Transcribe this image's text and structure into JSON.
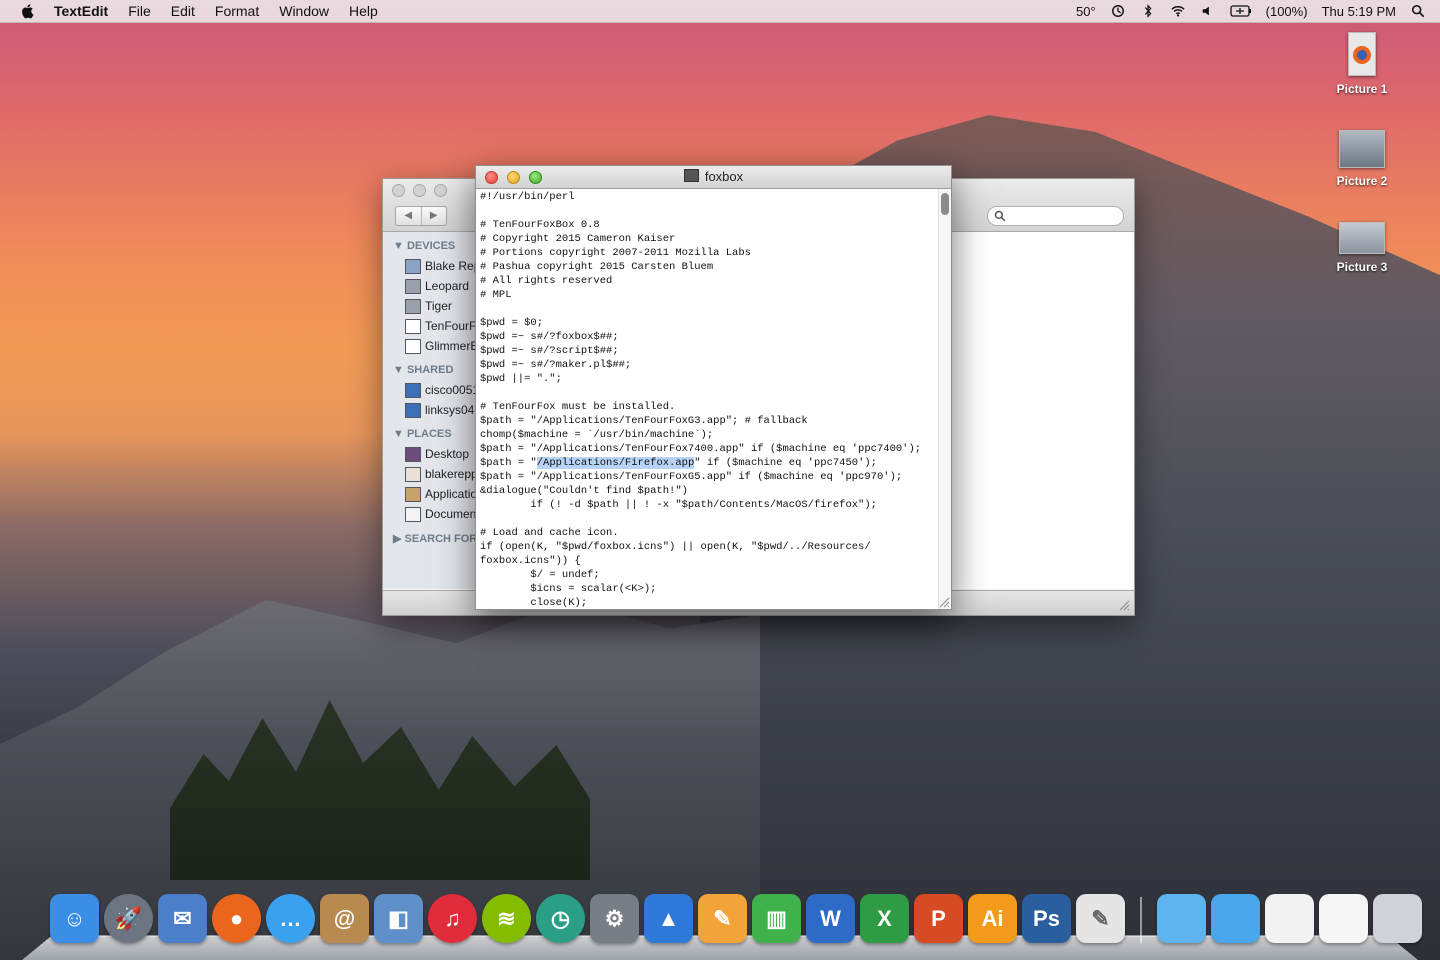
{
  "menubar": {
    "app_name": "TextEdit",
    "menus": [
      "File",
      "Edit",
      "Format",
      "Window",
      "Help"
    ],
    "status": {
      "temperature": "50°",
      "battery": "(100%)",
      "clock": "Thu 5:19 PM"
    }
  },
  "desktop_icons": [
    {
      "label": "Picture 1"
    },
    {
      "label": "Picture 2"
    },
    {
      "label": "Picture 3"
    }
  ],
  "finder": {
    "sidebar": {
      "devices_header": "DEVICES",
      "devices": [
        "Blake Rep",
        "Leopard",
        "Tiger",
        "TenFourF",
        "GlimmerB"
      ],
      "shared_header": "SHARED",
      "shared": [
        "cisco0051",
        "linksys04"
      ],
      "places_header": "PLACES",
      "places": [
        "Desktop",
        "blakerepp",
        "Applicatio",
        "Documen"
      ],
      "search_header": "SEARCH FOR"
    }
  },
  "textedit": {
    "title": "foxbox",
    "code": {
      "before": "#!/usr/bin/perl\n\n# TenFourFoxBox 0.8\n# Copyright 2015 Cameron Kaiser\n# Portions copyright 2007-2011 Mozilla Labs\n# Pashua copyright 2015 Carsten Bluem\n# All rights reserved\n# MPL\n\n$pwd = $0;\n$pwd =~ s#/?foxbox$##;\n$pwd =~ s#/?script$##;\n$pwd =~ s#/?maker.pl$##;\n$pwd ||= \".\";\n\n# TenFourFox must be installed.\n$path = \"/Applications/TenFourFoxG3.app\"; # fallback\nchomp($machine = `/usr/bin/machine`);\n$path = \"/Applications/TenFourFox7400.app\" if ($machine eq 'ppc7400');\n$path = \"",
      "selected": "/Applications/Firefox.app",
      "after": "\" if ($machine eq 'ppc7450');\n$path = \"/Applications/TenFourFoxG5.app\" if ($machine eq 'ppc970');\n&dialogue(\"Couldn't find $path!\")\n        if (! -d $path || ! -x \"$path/Contents/MacOS/firefox\");\n\n# Load and cache icon.\nif (open(K, \"$pwd/foxbox.icns\") || open(K, \"$pwd/../Resources/\nfoxbox.icns\")) {\n        $/ = undef;\n        $icns = scalar(<K>);\n        close(K);"
    }
  },
  "dock": {
    "items": [
      {
        "name": "finder",
        "glyph": "☺",
        "color": "#3a8ee6"
      },
      {
        "name": "launchpad",
        "glyph": "🚀",
        "color": "#6b7480"
      },
      {
        "name": "mail",
        "glyph": "✉",
        "color": "#4b7fc9"
      },
      {
        "name": "firefox",
        "glyph": "●",
        "color": "#e9661c"
      },
      {
        "name": "messages",
        "glyph": "…",
        "color": "#3aa1f0"
      },
      {
        "name": "contacts",
        "glyph": "@",
        "color": "#b88a4f"
      },
      {
        "name": "preview",
        "glyph": "◧",
        "color": "#5e8fc9"
      },
      {
        "name": "itunes",
        "glyph": "♫",
        "color": "#e02b3b"
      },
      {
        "name": "spotify",
        "glyph": "≋",
        "color": "#84bd00"
      },
      {
        "name": "time-machine",
        "glyph": "◷",
        "color": "#2a9f86"
      },
      {
        "name": "system-preferences",
        "glyph": "⚙",
        "color": "#777e86"
      },
      {
        "name": "keynote",
        "glyph": "▲",
        "color": "#2f7ad8"
      },
      {
        "name": "pages",
        "glyph": "✎",
        "color": "#f2a33a"
      },
      {
        "name": "numbers",
        "glyph": "▥",
        "color": "#3fb24c"
      },
      {
        "name": "word",
        "glyph": "W",
        "color": "#2e6bc6"
      },
      {
        "name": "excel",
        "glyph": "X",
        "color": "#2e9b45"
      },
      {
        "name": "powerpoint",
        "glyph": "P",
        "color": "#d64a24"
      },
      {
        "name": "illustrator",
        "glyph": "Ai",
        "color": "#f39a1a"
      },
      {
        "name": "photoshop",
        "glyph": "Ps",
        "color": "#2b5e9e"
      },
      {
        "name": "textedit",
        "glyph": "✎",
        "color": "#e5e5e5"
      }
    ],
    "right_items": [
      {
        "name": "documents-stack",
        "color": "#5fb3ef"
      },
      {
        "name": "downloads-stack",
        "color": "#4aa6ea"
      },
      {
        "name": "picture-stack",
        "color": "#f2f2f2"
      },
      {
        "name": "document-stack",
        "color": "#f6f6f6"
      },
      {
        "name": "trash",
        "color": "#cfd3d8"
      }
    ]
  }
}
